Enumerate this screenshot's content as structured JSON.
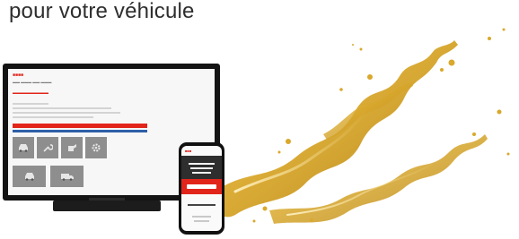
{
  "headline": "pour votre véhicule",
  "colors": {
    "brand_red": "#e1251b",
    "headline_text": "#2e2e2e",
    "monitor_bezel": "#141414",
    "oil_gold": "#d9a82c"
  },
  "illustration": {
    "monitor_icons": [
      "car-icon",
      "wrench-icon",
      "oil-can-icon",
      "gear-icon",
      "car-icon",
      "truck-icon"
    ],
    "phone_icons": []
  }
}
